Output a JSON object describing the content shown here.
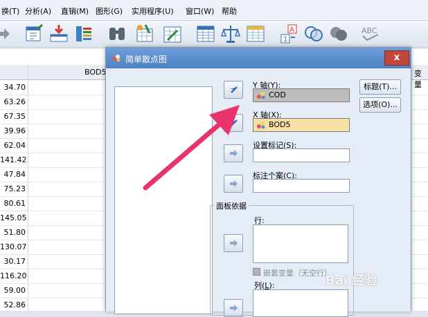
{
  "menu": {
    "items": [
      "换(T)",
      "分析(A)",
      "直销(M)",
      "图形(G)",
      "实用程序(U)",
      "窗口(W)",
      "帮助"
    ]
  },
  "grid": {
    "column_header": "BOD5",
    "right_header": "变量",
    "values": [
      "34.70",
      "63.26",
      "67.35",
      "39.96",
      "62.04",
      "141.42",
      "47.84",
      "75.23",
      "80.61",
      "145.05",
      "51.80",
      "130.07",
      "30.17",
      "116.20",
      "59.00",
      "52.86"
    ]
  },
  "dialog": {
    "title": "简单散点图",
    "close_label": "x",
    "y_axis": {
      "label_prefix": "Y",
      "label_rest": " 轴(Y):",
      "value": "COD"
    },
    "x_axis": {
      "label_prefix": "X",
      "label_rest": " 轴(X):",
      "value": "BOD5"
    },
    "set_markers": {
      "label_main": "设置标记(",
      "label_key": "S",
      "label_end": "):"
    },
    "label_cases": {
      "label_main": "标注个案(",
      "label_key": "C",
      "label_end": "):"
    },
    "panel_by": {
      "title": "面板依据",
      "rows_label": "行:",
      "nest_label": "嵌套变量（无空行）",
      "cols_label_main": "列(",
      "cols_label_key": "L",
      "cols_label_end": "):"
    },
    "buttons": {
      "titles": "标题(T)...",
      "options": "选项(O)..."
    }
  },
  "watermark": "Bai 经验",
  "colors": {
    "accent_title": "#4d80c4",
    "filled_field": "#f7e0a8",
    "y_field": "#bdbdbd",
    "arrow": "#e8336b",
    "close": "#c4453a"
  },
  "icons": [
    "recall-dialog-icon",
    "goto-case-icon",
    "variables-icon",
    "find-icon",
    "insert-cases-icon",
    "insert-variable-icon",
    "split-file-icon",
    "weight-cases-icon",
    "select-cases-icon",
    "value-labels-icon",
    "use-sets-icon",
    "show-all-icon",
    "spell-check-icon",
    "move-arrow-icon",
    "variable-icon",
    "close-icon"
  ]
}
